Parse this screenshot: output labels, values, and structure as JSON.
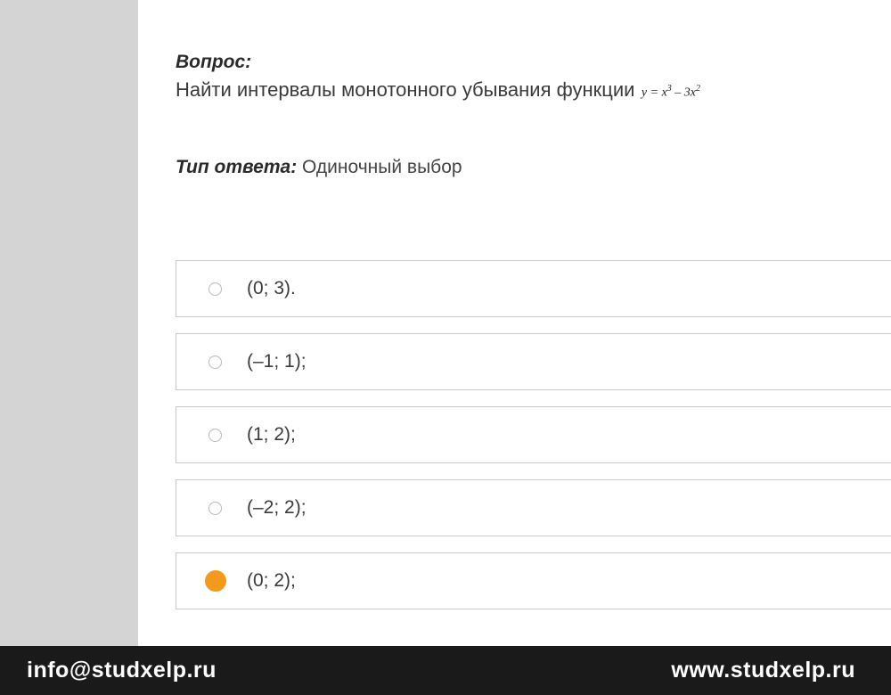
{
  "question": {
    "label": "Вопрос:",
    "text": "Найти интервалы монотонного убывания функции",
    "formula_plain": "y = x³ – 3x²"
  },
  "answer_type": {
    "label": "Тип ответа:",
    "value": "Одиночный выбор"
  },
  "options": [
    {
      "text": "(0; 3).",
      "selected": false
    },
    {
      "text": "(–1; 1);",
      "selected": false
    },
    {
      "text": "(1; 2);",
      "selected": false
    },
    {
      "text": "(–2; 2);",
      "selected": false
    },
    {
      "text": "(0; 2);",
      "selected": true
    }
  ],
  "footer": {
    "email": "info@studxelp.ru",
    "website": "www.studxelp.ru"
  }
}
